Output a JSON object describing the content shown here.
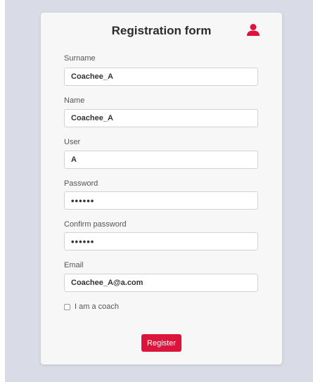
{
  "form": {
    "title": "Registration form",
    "accent_color": "#dc143c",
    "header_icon": "user-icon",
    "fields": {
      "surname": {
        "label": "Surname",
        "value": "Coachee_A"
      },
      "name": {
        "label": "Name",
        "value": "Coachee_A"
      },
      "user": {
        "label": "User",
        "value": "A"
      },
      "password": {
        "label": "Password",
        "value": "••••••"
      },
      "confirm_password": {
        "label": "Confirm password",
        "value": "••••••"
      },
      "email": {
        "label": "Email",
        "value": "Coachee_A@a.com"
      }
    },
    "coach_checkbox": {
      "label": "I am a coach",
      "checked": false
    },
    "register_label": "Register"
  }
}
